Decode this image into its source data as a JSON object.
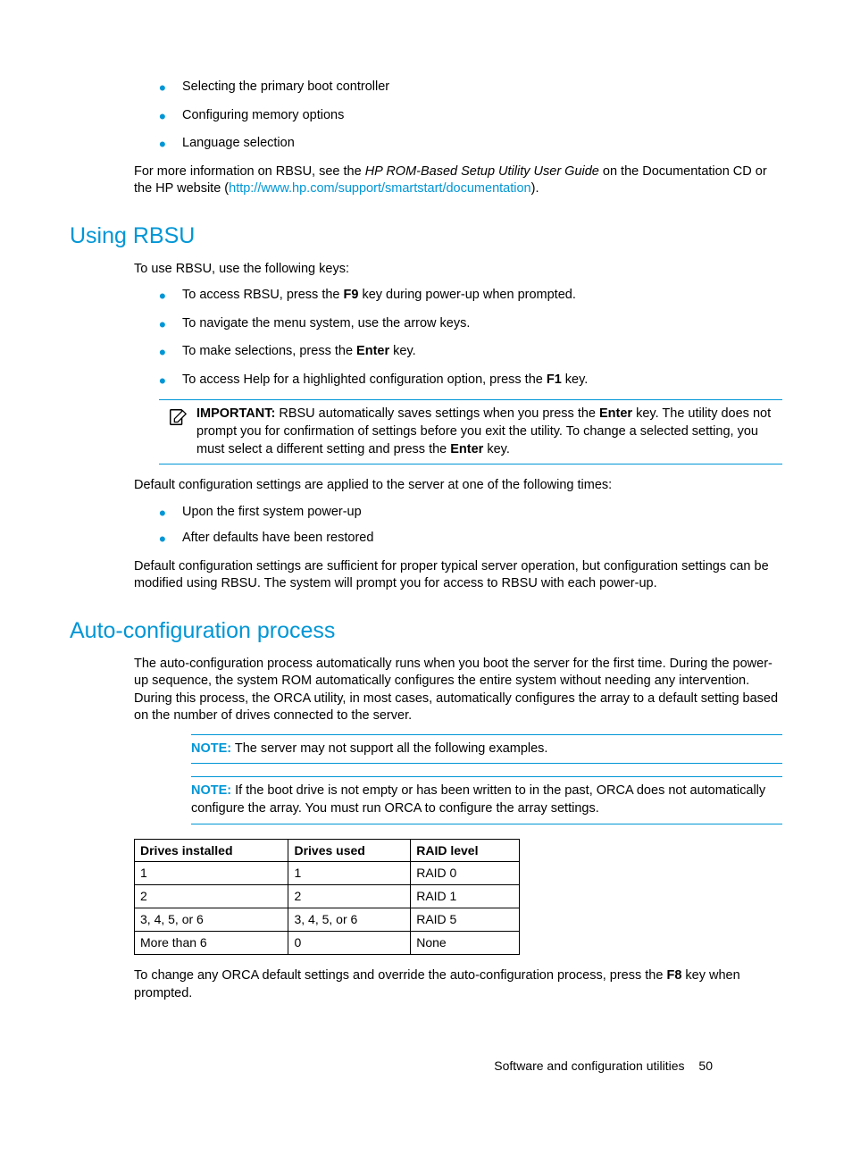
{
  "intro": {
    "bullets": [
      "Selecting the primary boot controller",
      "Configuring memory options",
      "Language selection"
    ],
    "more_info_pre": "For more information on RBSU, see the ",
    "more_info_em": "HP ROM-Based Setup Utility User Guide",
    "more_info_mid": " on the Documentation CD or the HP website (",
    "more_info_link": "http://www.hp.com/support/smartstart/documentation",
    "more_info_post": ")."
  },
  "using": {
    "heading": "Using RBSU",
    "p1": "To use RBSU, use the following keys:",
    "items": [
      {
        "pre": "To access RBSU, press the ",
        "b1": "F9",
        "post": " key during power-up when prompted."
      },
      {
        "pre": "To navigate the menu system, use the arrow keys.",
        "b1": "",
        "post": ""
      },
      {
        "pre": "To make selections, press the ",
        "b1": "Enter",
        "post": " key."
      },
      {
        "pre": "To access Help for a highlighted configuration option, press the ",
        "b1": "F1",
        "post": " key."
      }
    ],
    "important_label": "IMPORTANT:",
    "important_pre": "  RBSU automatically saves settings when you press the ",
    "important_b1": "Enter",
    "important_mid": " key. The utility does not prompt you for confirmation of settings before you exit the utility. To change a selected setting, you must select a different setting and press the ",
    "important_b2": "Enter",
    "important_post": " key.",
    "p2": "Default configuration settings are applied to the server at one of the following times:",
    "bullets2": [
      "Upon the first system power-up",
      "After defaults have been restored"
    ],
    "p3": "Default configuration settings are sufficient for proper typical server operation, but configuration settings can be modified using RBSU. The system will prompt you for access to RBSU with each power-up."
  },
  "auto": {
    "heading": "Auto-configuration process",
    "p1": "The auto-configuration process automatically runs when you boot the server for the first time. During the power-up sequence, the system ROM automatically configures the entire system without needing any intervention. During this process, the ORCA utility, in most cases, automatically configures the array to a default setting based on the number of drives connected to the server.",
    "note1_label": "NOTE:",
    "note1_text": "  The server may not support all the following examples.",
    "note2_label": "NOTE:",
    "note2_text": "  If the boot drive is not empty or has been written to in the past, ORCA does not automatically configure the array. You must run ORCA to configure the array settings.",
    "table": {
      "headers": [
        "Drives installed",
        "Drives used",
        "RAID level"
      ],
      "rows": [
        [
          "1",
          "1",
          "RAID 0"
        ],
        [
          "2",
          "2",
          "RAID 1"
        ],
        [
          "3, 4, 5, or 6",
          "3, 4, 5, or 6",
          "RAID 5"
        ],
        [
          "More than 6",
          "0",
          "None"
        ]
      ]
    },
    "p2_pre": "To change any ORCA default settings and override the auto-configuration process, press the ",
    "p2_b": "F8",
    "p2_post": " key when prompted."
  },
  "footer": {
    "section": "Software and configuration utilities",
    "page": "50"
  }
}
